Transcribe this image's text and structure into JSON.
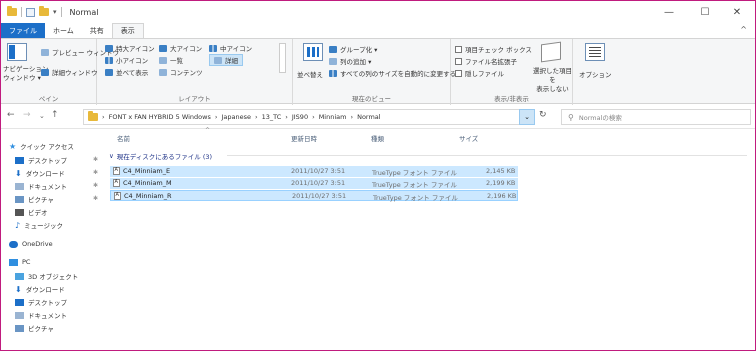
{
  "window": {
    "title": "Normal",
    "minimize": "—",
    "maximize": "☐",
    "close": "✕"
  },
  "tabs": [
    "ファイル",
    "ホーム",
    "共有",
    "表示"
  ],
  "ribbon": {
    "panes": {
      "nav_pane": "ナビゲーション\nウィンドウ ▾",
      "preview_pane": "プレビュー ウィンドウ",
      "details_pane": "詳細ウィンドウ",
      "label": "ペイン"
    },
    "layout": {
      "xl_icons": "特大アイコン",
      "large_icons": "大アイコン",
      "medium_icons": "中アイコン",
      "small_icons": "小アイコン",
      "list": "一覧",
      "details": "詳細",
      "tiles": "並べて表示",
      "content": "コンテンツ",
      "label": "レイアウト"
    },
    "current_view": {
      "sort_by": "並べ替え",
      "group_by": "グループ化 ▾",
      "add_columns": "列の追加 ▾",
      "size_all_columns": "すべての列のサイズを自動的に変更する",
      "label": "現在のビュー"
    },
    "show_hide": {
      "item_checkboxes": "項目チェック ボックス",
      "file_extensions": "ファイル名拡張子",
      "hidden_items": "隠しファイル",
      "hide_selected": "選択した項目を\n表示しない",
      "label": "表示/非表示"
    },
    "options": "オプション"
  },
  "address": {
    "path": [
      "FONT x FAN HYBRID 5 Windows",
      "Japanese",
      "13_TC",
      "JIS90",
      "Minniam",
      "Normal"
    ],
    "sep": "›",
    "search_placeholder": "Normalの検索"
  },
  "navpane": {
    "quick_access": "クイック アクセス",
    "quick_items": [
      "デスクトップ",
      "ダウンロード",
      "ドキュメント",
      "ピクチャ",
      "ビデオ",
      "ミュージック"
    ],
    "onedrive": "OneDrive",
    "pc": "PC",
    "pc_items": [
      "3D オブジェクト",
      "ダウンロード",
      "デスクトップ",
      "ドキュメント",
      "ピクチャ"
    ]
  },
  "columns": {
    "name": "名前",
    "date": "更新日時",
    "type": "種類",
    "size": "サイズ"
  },
  "group": {
    "label": "現在ディスクにあるファイル (3)"
  },
  "files": [
    {
      "name": "C4_Minniam_E",
      "date": "2011/10/27 3:51",
      "type": "TrueType フォント ファイル",
      "size": "2,145 KB"
    },
    {
      "name": "C4_Minniam_M",
      "date": "2011/10/27 3:51",
      "type": "TrueType フォント ファイル",
      "size": "2,199 KB"
    },
    {
      "name": "C4_Minniam_R",
      "date": "2011/10/27 3:51",
      "type": "TrueType フォント ファイル",
      "size": "2,196 KB"
    }
  ],
  "colors": {
    "accent": "#1c6fc8",
    "selection": "#cce8ff",
    "frame": "#c01b7e"
  }
}
